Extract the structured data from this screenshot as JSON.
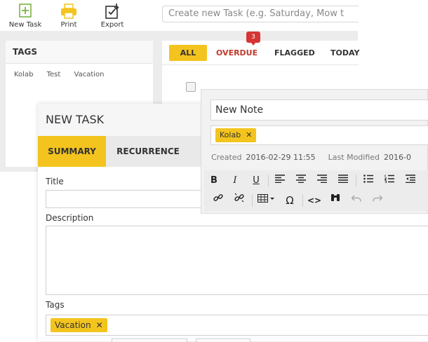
{
  "toolbar": {
    "new_task": "New Task",
    "print": "Print",
    "export": "Export",
    "search_placeholder": "Create new Task (e.g. Saturday, Mow t"
  },
  "tags_panel": {
    "title": "TAGS",
    "tags": [
      "Kolab",
      "Test",
      "Vacation"
    ]
  },
  "filters": {
    "all": "ALL",
    "overdue": "OVERDUE",
    "overdue_count": "3",
    "flagged": "FLAGGED",
    "today": "TODAY"
  },
  "task_dialog": {
    "title": "NEW TASK",
    "tabs": [
      "SUMMARY",
      "RECURRENCE"
    ],
    "title_label": "Title",
    "description_label": "Description",
    "tags_label": "Tags",
    "tags": [
      "Vacation"
    ]
  },
  "note": {
    "title": "New Note",
    "tags": [
      "Kolab"
    ],
    "created_label": "Created",
    "created_value": "2016-02-29 11:55",
    "modified_label": "Last Modified",
    "modified_value": "2016-0"
  },
  "editor_icons": [
    "bold-icon",
    "italic-icon",
    "underline-icon",
    "align-left-icon",
    "align-center-icon",
    "align-right-icon",
    "justify-icon",
    "bullet-list-icon",
    "numbered-list-icon",
    "outdent-icon",
    "link-icon",
    "unlink-icon",
    "table-icon",
    "special-char-icon",
    "source-code-icon",
    "find-icon",
    "undo-icon",
    "redo-icon"
  ],
  "colors": {
    "accent": "#f3c41e",
    "overdue": "#c0392b",
    "badge": "#d63535"
  }
}
